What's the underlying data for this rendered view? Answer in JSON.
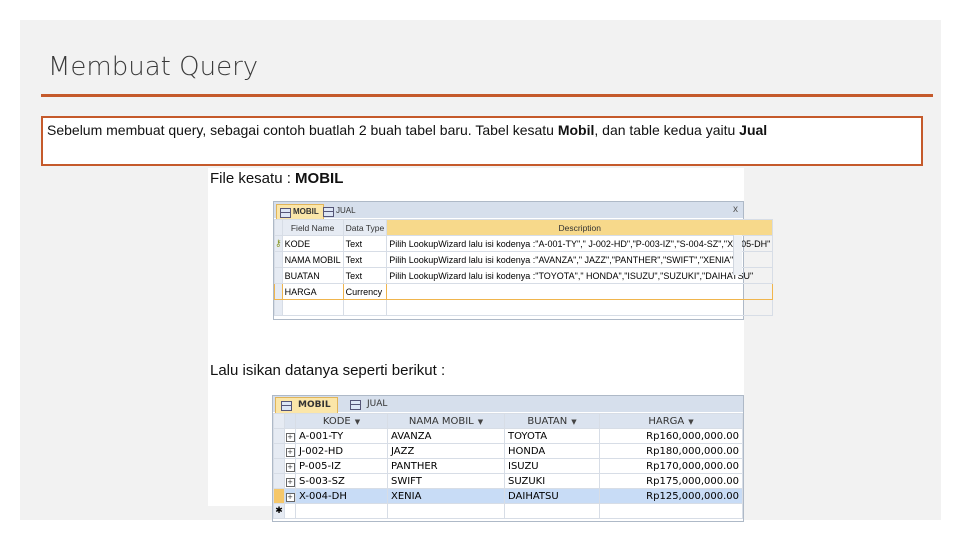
{
  "slide": {
    "title": "Membuat Query",
    "intro_a": "Sebelum membuat query, sebagai contoh buatlah 2 buah tabel baru. Tabel kesatu ",
    "intro_b": "Mobil",
    "intro_c": ", dan table kedua yaitu ",
    "intro_d": "Jual"
  },
  "screenshot": {
    "heading1_a": "File kesatu : ",
    "heading1_b": "MOBIL",
    "heading2": "Lalu isikan datanya seperti berikut :",
    "design": {
      "tabs": [
        "MOBIL",
        "JUAL"
      ],
      "close": "x",
      "columns": [
        "Field Name",
        "Data Type",
        "Description"
      ],
      "rows": [
        {
          "field": "KODE",
          "type": "Text",
          "desc": "Pilih LookupWizard lalu isi kodenya :\"A-001-TY\",\" J-002-HD\",\"P-003-IZ\",\"S-004-SZ\",\"X-005-DH\""
        },
        {
          "field": "NAMA MOBIL",
          "type": "Text",
          "desc": "Pilih LookupWizard lalu isi kodenya :\"AVANZA\",\" JAZZ\",\"PANTHER\",\"SWIFT\",\"XENIA\""
        },
        {
          "field": "BUATAN",
          "type": "Text",
          "desc": "Pilih LookupWizard lalu isi kodenya :\"TOYOTA\",\" HONDA\",\"ISUZU\",\"SUZUKI\",\"DAIHATSU\""
        },
        {
          "field": "HARGA",
          "type": "Currency",
          "desc": ""
        }
      ]
    },
    "datasheet": {
      "tabs": [
        "MOBIL",
        "JUAL"
      ],
      "columns": [
        "KODE",
        "NAMA MOBIL",
        "BUATAN",
        "HARGA"
      ],
      "rows": [
        {
          "kode": "A-001-TY",
          "nama": "AVANZA",
          "buatan": "TOYOTA",
          "harga": "Rp160,000,000.00"
        },
        {
          "kode": "J-002-HD",
          "nama": "JAZZ",
          "buatan": "HONDA",
          "harga": "Rp180,000,000.00"
        },
        {
          "kode": "P-005-IZ",
          "nama": "PANTHER",
          "buatan": "ISUZU",
          "harga": "Rp170,000,000.00"
        },
        {
          "kode": "S-003-SZ",
          "nama": "SWIFT",
          "buatan": "SUZUKI",
          "harga": "Rp175,000,000.00"
        },
        {
          "kode": "X-004-DH",
          "nama": "XENIA",
          "buatan": "DAIHATSU",
          "harga": "Rp125,000,000.00"
        }
      ],
      "new_row_marker": "✱",
      "expand_glyph": "+"
    }
  },
  "colors": {
    "accent": "#c55a2b",
    "slide_bg": "#f2f2f2",
    "selected_row": "#c8dcf6"
  }
}
